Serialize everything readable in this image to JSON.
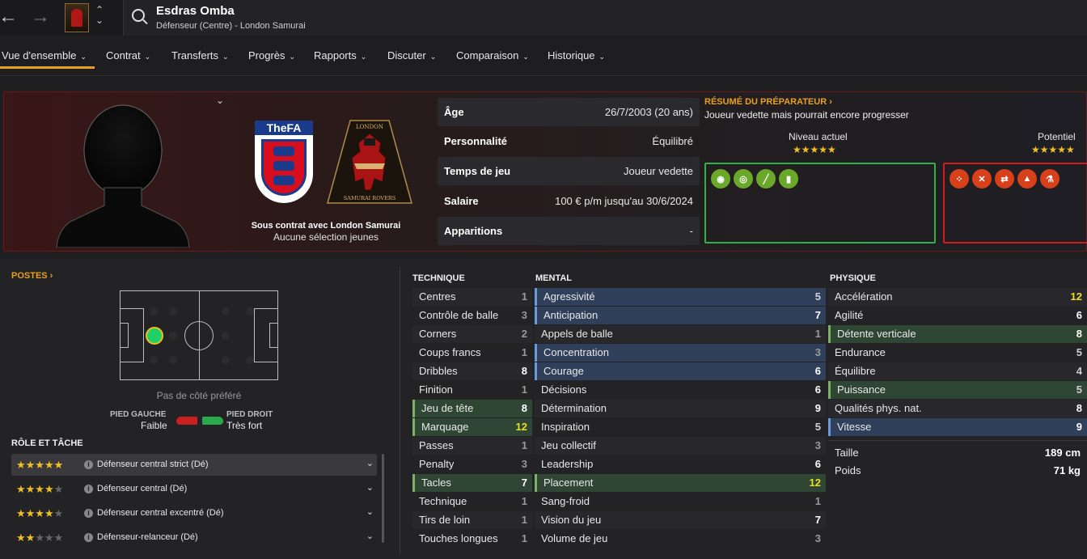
{
  "header": {
    "player_name": "Esdras Omba",
    "player_sub": "Défenseur (Centre) - London Samurai",
    "back_icon": "←",
    "forward_icon": "→",
    "up_icon": "⌃",
    "down_icon": "⌄"
  },
  "tabs": [
    {
      "label": "Vue d'ensemble",
      "chev": "⌄"
    },
    {
      "label": "Contrat",
      "chev": "⌄"
    },
    {
      "label": "Transferts",
      "chev": "⌄"
    },
    {
      "label": "Progrès",
      "chev": "⌄"
    },
    {
      "label": "Rapports",
      "chev": "⌄"
    },
    {
      "label": "Discuter",
      "chev": "⌄"
    },
    {
      "label": "Comparaison",
      "chev": "⌄"
    },
    {
      "label": "Historique",
      "chev": "⌄"
    }
  ],
  "hero": {
    "fa_text": "TheFA",
    "club_text_top": "LONDON",
    "club_text_bottom": "SAMURAI ROVERS",
    "contract_line": "Sous contrat avec London Samurai",
    "youth_caps": "Aucune sélection jeunes",
    "expand_chev": "⌄",
    "info": [
      {
        "label": "Âge",
        "value": "26/7/2003 (20 ans)"
      },
      {
        "label": "Personnalité",
        "value": "Équilibré"
      },
      {
        "label": "Temps de jeu",
        "value": "Joueur vedette"
      },
      {
        "label": "Salaire",
        "value": "100 € p/m jusqu'au 30/6/2024"
      },
      {
        "label": "Apparitions",
        "value": "-"
      }
    ],
    "coach": {
      "title": "RÉSUMÉ DU PRÉPARATEUR ›",
      "text": "Joueur vedette mais pourrait encore progresser",
      "current_label": "Niveau actuel",
      "potential_label": "Potentiel",
      "current_stars": 5,
      "potential_stars": 5
    },
    "strengths_icons": [
      "brain-icon",
      "target-icon",
      "boot-icon",
      "figure-icon"
    ],
    "weakness_icons": [
      "dice-icon",
      "tool-icon",
      "arrows-icon",
      "cone-icon",
      "flask-icon"
    ],
    "strength_color": "#2fb04a",
    "weakness_color": "#d21c1c"
  },
  "positions": {
    "title": "POSTES ›",
    "side_note": "Pas de côté préféré",
    "left_foot_label": "PIED GAUCHE",
    "left_foot_value": "Faible",
    "right_foot_label": "PIED DROIT",
    "right_foot_value": "Très fort"
  },
  "roles": {
    "title": "RÔLE ET TÂCHE",
    "items": [
      {
        "stars": "★★★★★",
        "off": "",
        "name": "Défenseur central strict (Dé)"
      },
      {
        "stars": "★★★★",
        "off": "★",
        "name": "Défenseur central (Dé)"
      },
      {
        "stars": "★★★★",
        "off": "★",
        "name": "Défenseur central excentré (Dé)"
      },
      {
        "stars": "★★",
        "off": "★★★",
        "name": "Défenseur-relanceur (Dé)"
      }
    ]
  },
  "technique": {
    "title": "TECHNIQUE",
    "items": [
      {
        "name": "Centres",
        "value": "1"
      },
      {
        "name": "Contrôle de balle",
        "value": "3"
      },
      {
        "name": "Corners",
        "value": "2"
      },
      {
        "name": "Coups francs",
        "value": "1"
      },
      {
        "name": "Dribbles",
        "value": "8"
      },
      {
        "name": "Finition",
        "value": "1"
      },
      {
        "name": "Jeu de tête",
        "value": "8"
      },
      {
        "name": "Marquage",
        "value": "12"
      },
      {
        "name": "Passes",
        "value": "1"
      },
      {
        "name": "Penalty",
        "value": "3"
      },
      {
        "name": "Tacles",
        "value": "7"
      },
      {
        "name": "Technique",
        "value": "1"
      },
      {
        "name": "Tirs de loin",
        "value": "1"
      },
      {
        "name": "Touches longues",
        "value": "1"
      }
    ]
  },
  "mental": {
    "title": "MENTAL",
    "items": [
      {
        "name": "Agressivité",
        "value": "5"
      },
      {
        "name": "Anticipation",
        "value": "7"
      },
      {
        "name": "Appels de balle",
        "value": "1"
      },
      {
        "name": "Concentration",
        "value": "3"
      },
      {
        "name": "Courage",
        "value": "6"
      },
      {
        "name": "Décisions",
        "value": "6"
      },
      {
        "name": "Détermination",
        "value": "9"
      },
      {
        "name": "Inspiration",
        "value": "5"
      },
      {
        "name": "Jeu collectif",
        "value": "3"
      },
      {
        "name": "Leadership",
        "value": "6"
      },
      {
        "name": "Placement",
        "value": "12"
      },
      {
        "name": "Sang-froid",
        "value": "1"
      },
      {
        "name": "Vision du jeu",
        "value": "7"
      },
      {
        "name": "Volume de jeu",
        "value": "3"
      }
    ]
  },
  "physique": {
    "title": "PHYSIQUE",
    "items": [
      {
        "name": "Accélération",
        "value": "12"
      },
      {
        "name": "Agilité",
        "value": "6"
      },
      {
        "name": "Détente verticale",
        "value": "8"
      },
      {
        "name": "Endurance",
        "value": "5"
      },
      {
        "name": "Équilibre",
        "value": "4"
      },
      {
        "name": "Puissance",
        "value": "5"
      },
      {
        "name": "Qualités phys. nat.",
        "value": "8"
      },
      {
        "name": "Vitesse",
        "value": "9"
      }
    ],
    "height_label": "Taille",
    "height_value": "189 cm",
    "weight_label": "Poids",
    "weight_value": "71 kg"
  }
}
